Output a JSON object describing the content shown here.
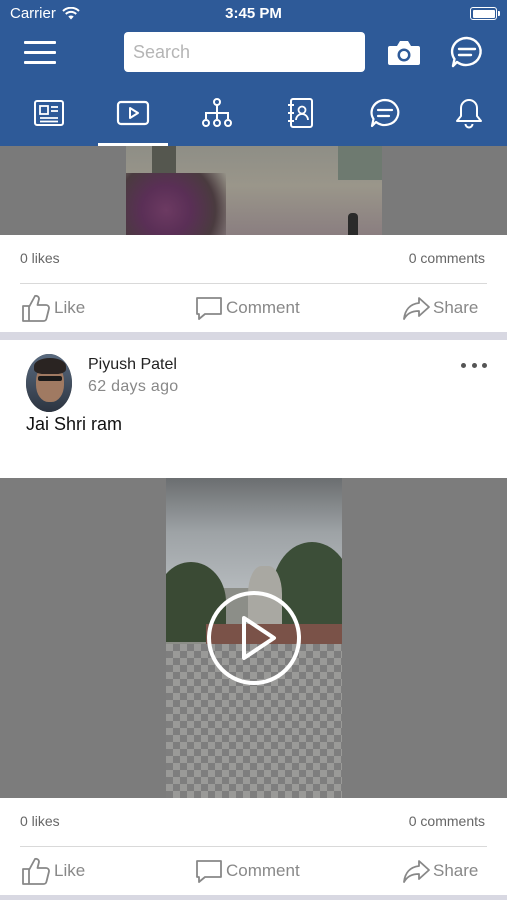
{
  "status_bar": {
    "carrier": "Carrier",
    "time": "3:45 PM"
  },
  "header": {
    "search_placeholder": "Search",
    "icons": [
      "menu-icon",
      "camera-icon",
      "chat-bubble-icon"
    ]
  },
  "tabs": [
    {
      "name": "news-feed",
      "icon": "newspaper-icon",
      "active": false
    },
    {
      "name": "videos",
      "icon": "play-video-icon",
      "active": true
    },
    {
      "name": "network",
      "icon": "org-chart-icon",
      "active": false
    },
    {
      "name": "contacts",
      "icon": "address-book-icon",
      "active": false
    },
    {
      "name": "messages",
      "icon": "chat-bubble-icon",
      "active": false
    },
    {
      "name": "notifications",
      "icon": "bell-icon",
      "active": false
    }
  ],
  "colors": {
    "brand": "#2e5a98",
    "feed_background": "#d8d8e2",
    "muted_text": "#888888"
  },
  "posts": [
    {
      "likes": "0 likes",
      "comments": "0 comments",
      "actions": {
        "like": "Like",
        "comment": "Comment",
        "share": "Share"
      }
    },
    {
      "author": "Piyush Patel",
      "posted": "62 days  ago",
      "text": "Jai Shri ram",
      "media": "video",
      "likes": "0 likes",
      "comments": "0 comments",
      "actions": {
        "like": "Like",
        "comment": "Comment",
        "share": "Share"
      }
    }
  ]
}
